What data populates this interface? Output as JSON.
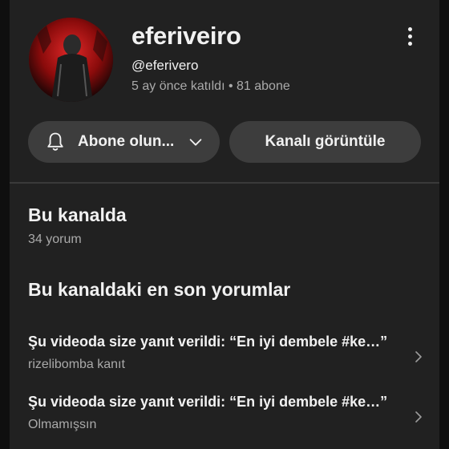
{
  "channel": {
    "name": "eferiveiro",
    "handle": "@eferivero",
    "meta": "5 ay önce katıldı • 81 abone"
  },
  "buttons": {
    "subscribe_label": "Abone olun...",
    "view_channel_label": "Kanalı görüntüle"
  },
  "section_on_channel": {
    "title": "Bu kanalda",
    "count": "34 yorum"
  },
  "section_recent": {
    "title": "Bu kanaldaki en son yorumlar",
    "items": [
      {
        "title": "Şu videoda size yanıt verildi: “En iyi dembele #ke…”",
        "subtitle": "rizelibomba kanıt"
      },
      {
        "title": "Şu videoda size yanıt verildi: “En iyi dembele #ke…”",
        "subtitle": "Olmamışsın"
      }
    ]
  },
  "icons": {
    "more": "more-vert-icon",
    "bell": "bell-icon",
    "chevron_down": "chevron-down-icon",
    "chevron_right": "chevron-right-icon"
  },
  "colors": {
    "background": "#212121",
    "button": "#3d3d3d",
    "secondary_text": "#aaaaaa"
  }
}
